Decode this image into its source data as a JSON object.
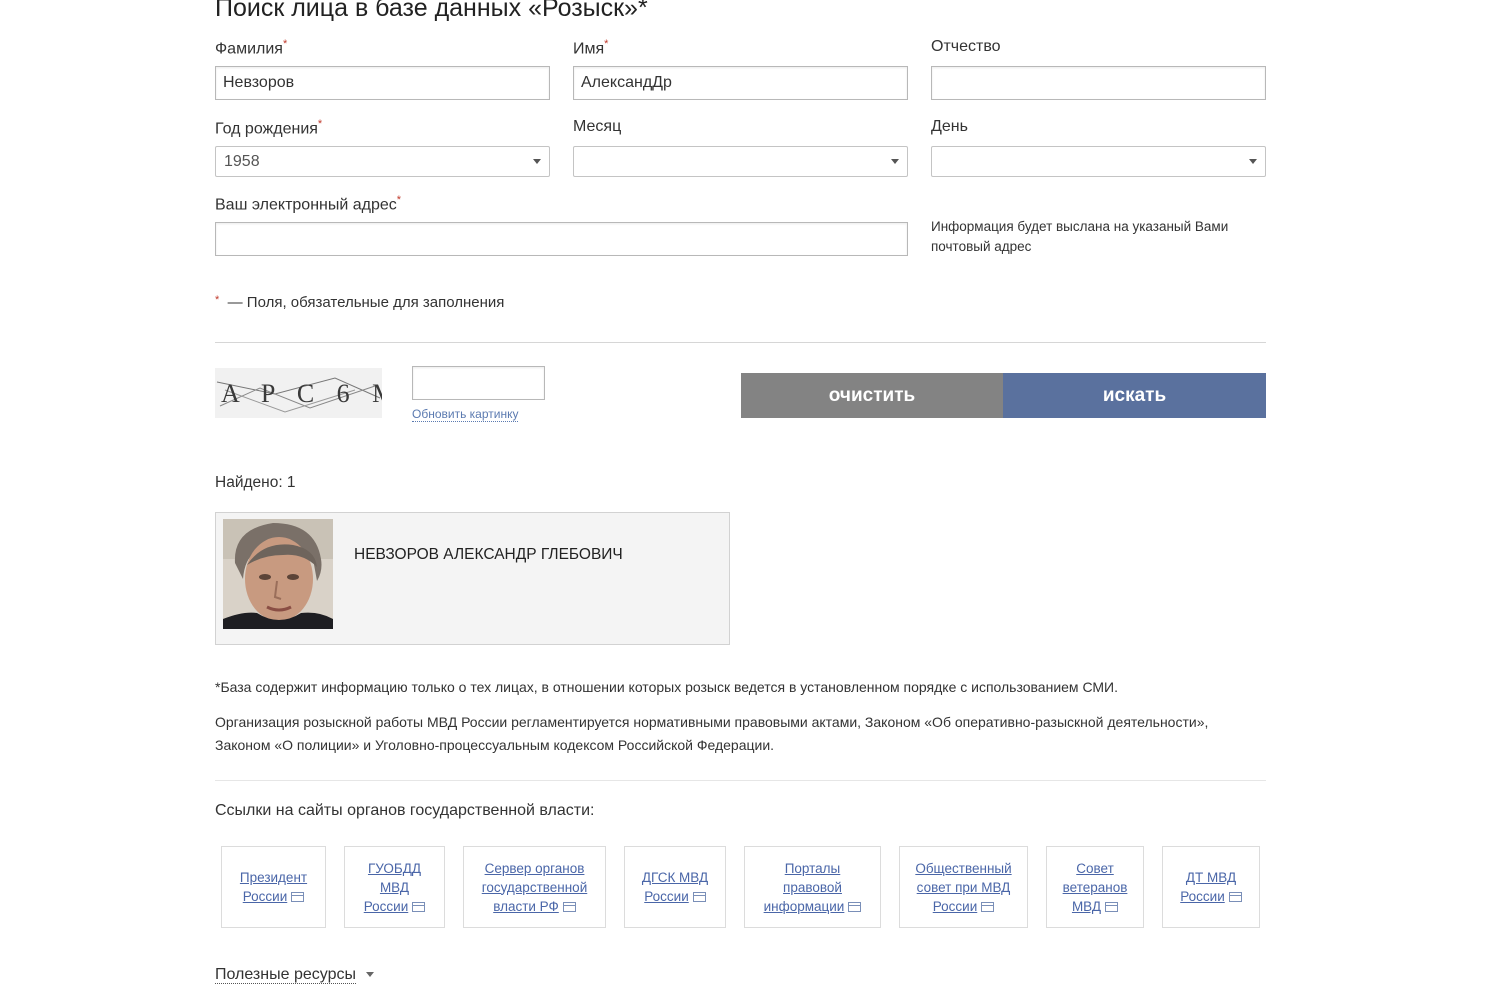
{
  "form": {
    "title": "Поиск лица в базе данных «Розыск»*",
    "surname_label": "Фамилия",
    "surname_value": "Невзоров",
    "name_label": "Имя",
    "name_value": "АлександДр",
    "patronymic_label": "Отчество",
    "patronymic_value": "",
    "birth_year_label": "Год рождения",
    "birth_year_value": "1958",
    "month_label": "Месяц",
    "month_value": "",
    "day_label": "День",
    "day_value": "",
    "email_label": "Ваш электронный адрес",
    "email_value": "",
    "email_hint": "Информация будет выслана на указаный Вами почтовый адрес",
    "required_star": "*",
    "required_note": "— Поля, обязательные для заполнения"
  },
  "captcha": {
    "text": "A P C 6 M",
    "refresh_label": "Обновить картинку",
    "input_value": ""
  },
  "actions": {
    "clear_label": "очистить",
    "search_label": "искать",
    "clear_color": "#838383",
    "search_color": "#5a719e"
  },
  "results": {
    "found_label": "Найдено: 1",
    "items": [
      {
        "name": "НЕВЗОРОВ АЛЕКСАНДР ГЛЕБОВИЧ"
      }
    ]
  },
  "footnotes": {
    "line1": "*База содержит информацию только о тех лицах, в отношении которых розыск ведется в установленном порядке с использованием СМИ.",
    "line2": "Организация розыскной работы МВД России регламентируется нормативными правовыми актами, Законом «Об оперативно-разыскной деятельности», Законом «О полиции» и Уголовно-процессуальным кодексом Российской Федерации."
  },
  "gov_links": {
    "heading": "Ссылки на сайты органов государственной власти:",
    "items": [
      {
        "label": "Президент России"
      },
      {
        "label": "ГУОБДД МВД России"
      },
      {
        "label": "Сервер органов государственной власти РФ"
      },
      {
        "label": "ДГСК МВД России"
      },
      {
        "label": "Порталы правовой информации"
      },
      {
        "label": "Общественный совет при МВД России"
      },
      {
        "label": "Совет ветеранов МВД"
      },
      {
        "label": "ДТ МВД России"
      }
    ]
  },
  "useful": {
    "label": "Полезные ресурсы"
  }
}
